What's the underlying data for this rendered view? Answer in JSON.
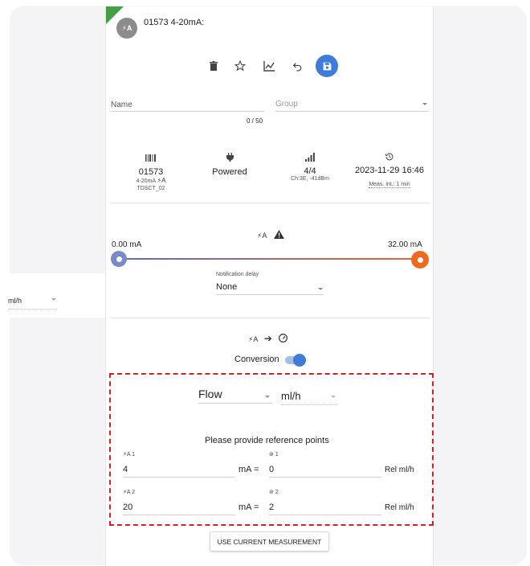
{
  "device": {
    "title": "01573 4-20mA:",
    "avatar_icon": "current-loop-icon",
    "avatar_text": "⚡A"
  },
  "toolbar": {
    "delete_icon": "trash-icon",
    "favorite_icon": "star-icon",
    "chart_icon": "chart-icon",
    "undo_icon": "undo-icon",
    "save_icon": "save-icon"
  },
  "form": {
    "name_label": "Name",
    "name_counter": "0 / 50",
    "group_placeholder": "Group"
  },
  "info": {
    "serial": "01573",
    "type": "4-20mA",
    "model": "TDSCT_02",
    "power": "Powered",
    "signal": "4/4",
    "signal_detail": "Ch:3E, -41dBm",
    "timestamp": "2023-11-29 16:46",
    "interval": "Meas. int.: 1 min"
  },
  "range": {
    "min_label": "0.00 mA",
    "max_label": "32.00 mA",
    "min_fraction": 0,
    "max_fraction": 1
  },
  "notification": {
    "label": "Notification delay",
    "value": "None"
  },
  "outside_unit": "ml/h",
  "conversion": {
    "label": "Conversion",
    "enabled": true,
    "quantity": "Flow",
    "unit": "ml/h"
  },
  "reference": {
    "heading": "Please provide reference points",
    "p1": {
      "in_label": "1",
      "out_label": "1",
      "in_value": "4",
      "in_unit": "mA =",
      "out_value": "0",
      "out_unit": "Rel ml/h"
    },
    "p2": {
      "in_label": "2",
      "out_label": "2",
      "in_value": "20",
      "in_unit": "mA =",
      "out_value": "2",
      "out_unit": "Rel ml/h"
    }
  },
  "actions": {
    "use_current": "USE CURRENT MEASUREMENT"
  },
  "colors": {
    "accent": "#3f7bd9",
    "warn": "#d32020",
    "green": "#43a047",
    "orange": "#f06a1d"
  }
}
